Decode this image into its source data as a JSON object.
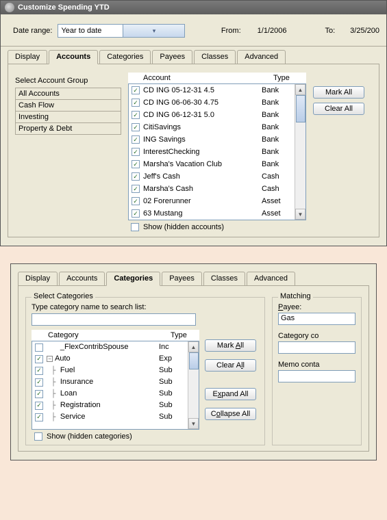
{
  "window1": {
    "title": "Customize Spending YTD",
    "dateRangeLabel": "Date range:",
    "dateRangeValue": "Year to date",
    "fromLabel": "From:",
    "fromValue": "1/1/2006",
    "toLabel": "To:",
    "toValue": "3/25/200",
    "tabs": {
      "display": "Display",
      "accounts": "Accounts",
      "categories": "Categories",
      "payees": "Payees",
      "classes": "Classes",
      "advanced": "Advanced"
    },
    "groupLabel": "Select Account Group",
    "groups": {
      "all": "All Accounts",
      "cash": "Cash Flow",
      "invest": "Investing",
      "prop": "Property & Debt"
    },
    "colAccount": "Account",
    "colType": "Type",
    "accounts": [
      {
        "name": "CD ING 05-12-31 4.5",
        "type": "Bank"
      },
      {
        "name": "CD ING 06-06-30 4.75",
        "type": "Bank"
      },
      {
        "name": "CD ING 06-12-31 5.0",
        "type": "Bank"
      },
      {
        "name": "CitiSavings",
        "type": "Bank"
      },
      {
        "name": "ING Savings",
        "type": "Bank"
      },
      {
        "name": "InterestChecking",
        "type": "Bank"
      },
      {
        "name": "Marsha's Vacation Club",
        "type": "Bank"
      },
      {
        "name": "Jeff's Cash",
        "type": "Cash"
      },
      {
        "name": "Marsha's Cash",
        "type": "Cash"
      },
      {
        "name": "02 Forerunner",
        "type": "Asset"
      },
      {
        "name": "63 Mustang",
        "type": "Asset"
      }
    ],
    "markAll": "Mark All",
    "clearAll": "Clear All",
    "showHidden": "Show (hidden accounts)"
  },
  "window2": {
    "tabs": {
      "display": "Display",
      "accounts": "Accounts",
      "categories": "Categories",
      "payees": "Payees",
      "classes": "Classes",
      "advanced": "Advanced"
    },
    "selectCategories": "Select Categories",
    "typeToSearch": "Type category name to search list:",
    "colCategory": "Category",
    "colType": "Type",
    "categories": [
      {
        "checked": false,
        "indent": 0,
        "exp": "",
        "name": "_FlexContribSpouse",
        "type": "Inc"
      },
      {
        "checked": true,
        "indent": 0,
        "exp": "-",
        "name": "Auto",
        "type": "Exp"
      },
      {
        "checked": true,
        "indent": 1,
        "exp": "",
        "name": "Fuel",
        "type": "Sub"
      },
      {
        "checked": true,
        "indent": 1,
        "exp": "",
        "name": "Insurance",
        "type": "Sub"
      },
      {
        "checked": true,
        "indent": 1,
        "exp": "",
        "name": "Loan",
        "type": "Sub"
      },
      {
        "checked": true,
        "indent": 1,
        "exp": "",
        "name": "Registration",
        "type": "Sub"
      },
      {
        "checked": true,
        "indent": 1,
        "exp": "",
        "name": "Service",
        "type": "Sub"
      }
    ],
    "markAll": "Mark All",
    "clearAll": "Clear All",
    "expandAll": "Expand All",
    "collapseAll": "Collapse All",
    "showHidden": "Show (hidden categories)",
    "matching": "Matching",
    "payeeLabel": "Payee:",
    "payeeValue": "Gas",
    "categoryContains": "Category co",
    "memoContains": "Memo conta"
  }
}
